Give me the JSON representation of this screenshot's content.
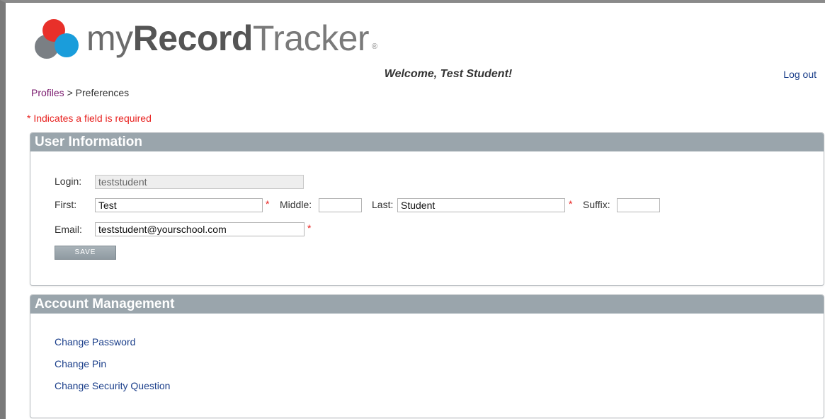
{
  "brand": {
    "prefix": "my",
    "bold": "Record",
    "suffix": "Tracker",
    "registered": "®",
    "colors": {
      "red": "#e8302a",
      "blue": "#1a9ddb",
      "gray": "#7a7f84"
    }
  },
  "header": {
    "welcome": "Welcome, Test Student!",
    "logout": "Log out"
  },
  "breadcrumb": {
    "link": "Profiles",
    "separator": " > ",
    "current": "Preferences"
  },
  "required_note": "* Indicates a field is required",
  "user_info": {
    "title": "User Information",
    "login_label": "Login:",
    "login_value": "teststudent",
    "first_label": "First:",
    "first_value": "Test",
    "middle_label": "Middle:",
    "middle_value": "",
    "last_label": "Last:",
    "last_value": "Student",
    "suffix_label": "Suffix:",
    "suffix_value": "",
    "email_label": "Email:",
    "email_value": "teststudent@yourschool.com",
    "required_mark": "*",
    "save_label": "SAVE"
  },
  "account": {
    "title": "Account Management",
    "links": [
      "Change Password",
      "Change Pin",
      "Change Security Question"
    ]
  }
}
